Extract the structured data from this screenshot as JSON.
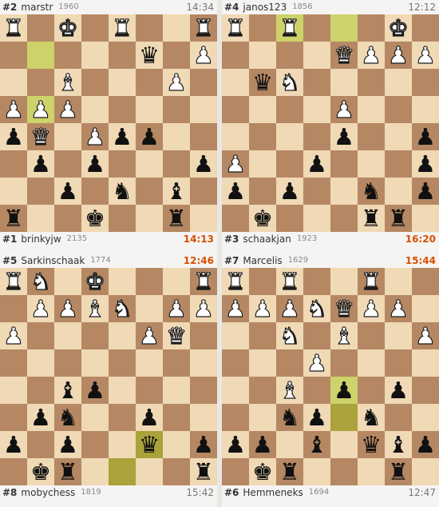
{
  "colors": {
    "light_square": "#f0d9b5",
    "dark_square": "#b58863",
    "highlight_light": "#cdd26a",
    "highlight_dark": "#aaa23a",
    "active_clock": "#d85000"
  },
  "glyphs": {
    "K": "♚",
    "Q": "♛",
    "R": "♜",
    "B": "♝",
    "N": "♞",
    "P": "♟"
  },
  "games": [
    {
      "id": "game-tl",
      "top": {
        "rank": "#2",
        "name": "marstr",
        "rating": "1960",
        "clock": "14:34",
        "active": false
      },
      "bottom": {
        "rank": "#1",
        "name": "brinkyjw",
        "rating": "2135",
        "clock": "14:13",
        "active": true
      },
      "highlights": [
        "b7",
        "b5"
      ],
      "board": [
        "wR",
        "",
        "wK",
        "",
        "wR",
        "",
        "",
        "wR",
        "",
        "",
        "",
        "",
        "",
        "bQ",
        "",
        "wP",
        "",
        "",
        "wB",
        "",
        "",
        "",
        "wP",
        "",
        "wP",
        "wP",
        "wP",
        "",
        "",
        "",
        "",
        "",
        "bP",
        "wQ",
        "",
        "wP",
        "bP",
        "bP",
        "",
        "",
        "",
        "bP",
        "",
        "bP",
        "",
        "",
        "",
        "bP",
        "",
        "",
        "bP",
        "",
        "bN",
        "",
        "bB",
        "",
        "bR",
        "",
        "",
        "bK",
        "",
        "",
        "bR",
        ""
      ]
    },
    {
      "id": "game-tr",
      "top": {
        "rank": "#4",
        "name": "janos123",
        "rating": "1856",
        "clock": "12:12",
        "active": false
      },
      "bottom": {
        "rank": "#3",
        "name": "schaakjan",
        "rating": "1923",
        "clock": "16:20",
        "active": true
      },
      "highlights": [
        "c8",
        "e8"
      ],
      "board": [
        "wR",
        "",
        "wR",
        "",
        "",
        "",
        "wK",
        "",
        "",
        "",
        "",
        "",
        "wQ",
        "wP",
        "wP",
        "wP",
        "",
        "bQ",
        "wN",
        "",
        "",
        "",
        "",
        "",
        "",
        "",
        "",
        "",
        "wP",
        "",
        "",
        "",
        "",
        "",
        "",
        "",
        "bP",
        "",
        "",
        "bP",
        "wP",
        "",
        "",
        "bP",
        "",
        "",
        "",
        "bP",
        "bP",
        "",
        "bP",
        "",
        "",
        "bN",
        "",
        "bP",
        "",
        "bK",
        "",
        "",
        "",
        "bR",
        "bR",
        ""
      ]
    },
    {
      "id": "game-bl",
      "top": {
        "rank": "#5",
        "name": "Sarkinschaak",
        "rating": "1774",
        "clock": "12:46",
        "active": true
      },
      "bottom": {
        "rank": "#8",
        "name": "mobychess",
        "rating": "1819",
        "clock": "15:42",
        "active": false
      },
      "highlights": [
        "f2",
        "e1"
      ],
      "board": [
        "wR",
        "wN",
        "",
        "wK",
        "",
        "",
        "",
        "wR",
        "",
        "wP",
        "wP",
        "wB",
        "wN",
        "",
        "wP",
        "wP",
        "wP",
        "",
        "",
        "",
        "",
        "wP",
        "wQ",
        "",
        "",
        "",
        "",
        "",
        "",
        "",
        "",
        "",
        "",
        "",
        "bB",
        "bP",
        "",
        "",
        "",
        "",
        "",
        "bP",
        "bN",
        "",
        "",
        "bP",
        "",
        "",
        "bP",
        "",
        "bP",
        "",
        "",
        "bQ",
        "",
        "bP",
        "",
        "bK",
        "bR",
        "",
        "",
        "",
        "",
        "bR"
      ]
    },
    {
      "id": "game-br",
      "top": {
        "rank": "#7",
        "name": "Marcelis",
        "rating": "1629",
        "clock": "15:44",
        "active": true
      },
      "bottom": {
        "rank": "#6",
        "name": "Hemmeneks",
        "rating": "1694",
        "clock": "12:47",
        "active": false
      },
      "highlights": [
        "e4",
        "e3"
      ],
      "board": [
        "wR",
        "",
        "wR",
        "",
        "",
        "wR",
        "",
        "",
        "wP",
        "wP",
        "wP",
        "wN",
        "wQ",
        "wP",
        "wP",
        "",
        "",
        "",
        "wN",
        "",
        "wB",
        "",
        "",
        "wP",
        "",
        "",
        "",
        "wP",
        "",
        "",
        "",
        "",
        "",
        "",
        "wB",
        "",
        "bP",
        "",
        "bP",
        "",
        "",
        "",
        "bN",
        "bP",
        "",
        "bN",
        "",
        "",
        "bP",
        "bP",
        "",
        "bB",
        "",
        "bQ",
        "bB",
        "bP",
        "",
        "bK",
        "bR",
        "",
        "",
        "",
        "bR",
        ""
      ]
    }
  ]
}
